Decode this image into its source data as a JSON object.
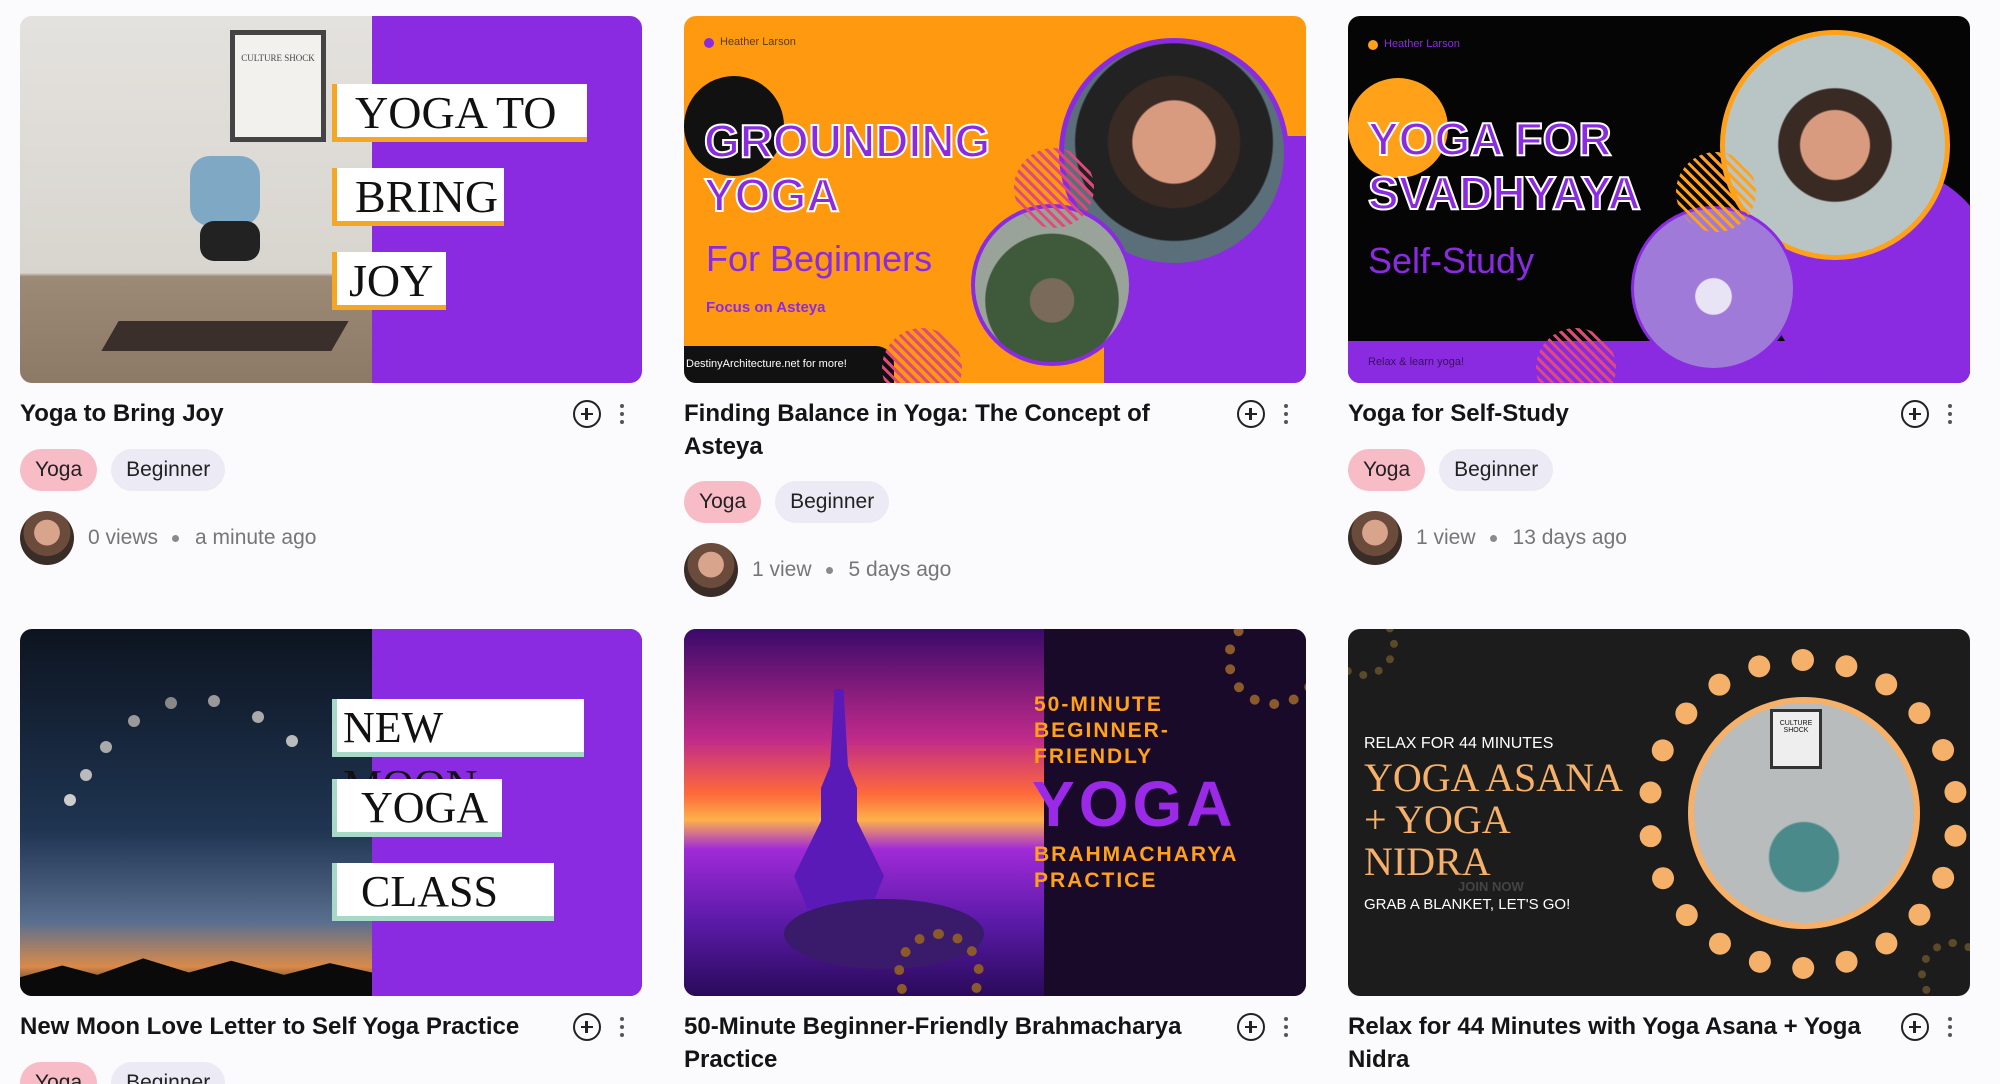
{
  "videos": [
    {
      "title": "Yoga to Bring Joy",
      "tags": [
        "Yoga",
        "Beginner"
      ],
      "views": "0 views",
      "age": "a minute ago",
      "thumb": {
        "lines": [
          "YOGA TO",
          "BRING",
          "JOY"
        ],
        "poster_text": "CULTURE SHOCK"
      }
    },
    {
      "title": "Finding Balance in Yoga: The Concept of Asteya",
      "tags": [
        "Yoga",
        "Beginner"
      ],
      "views": "1 view",
      "age": "5 days ago",
      "thumb": {
        "author": "Heather Larson",
        "heading1": "GROUNDING",
        "heading2": "YOGA",
        "subheading": "For Beginners",
        "focus": "Focus on Asteya",
        "footer": "DestinyArchitecture.net for more!"
      }
    },
    {
      "title": "Yoga for Self-Study",
      "tags": [
        "Yoga",
        "Beginner"
      ],
      "views": "1 view",
      "age": "13 days ago",
      "thumb": {
        "author": "Heather Larson",
        "heading1": "YOGA FOR",
        "heading2": "SVADHYAYA",
        "subheading": "Self-Study",
        "footer": "Relax & learn yoga!"
      }
    },
    {
      "title": "New Moon Love Letter to Self Yoga Practice",
      "tags": [
        "Yoga",
        "Beginner"
      ],
      "thumb": {
        "lines": [
          "NEW MOON",
          "YOGA",
          "CLASS"
        ]
      }
    },
    {
      "title": "50-Minute Beginner-Friendly Brahmacharya Practice",
      "thumb": {
        "line1": "50-MINUTE",
        "line2": "BEGINNER-",
        "line3": "FRIENDLY",
        "big": "YOGA",
        "line4": "BRAHMACHARYA",
        "line5": "PRACTICE"
      }
    },
    {
      "title": "Relax for 44 Minutes with Yoga Asana + Yoga Nidra",
      "thumb": {
        "kicker": "RELAX FOR 44 MINUTES",
        "line1": "YOGA ASANA",
        "line2": "+ YOGA",
        "line3": "NIDRA",
        "faint": "JOIN NOW",
        "cta": "GRAB A BLANKET, LET'S GO!",
        "poster_text": "CULTURE SHOCK"
      }
    }
  ]
}
